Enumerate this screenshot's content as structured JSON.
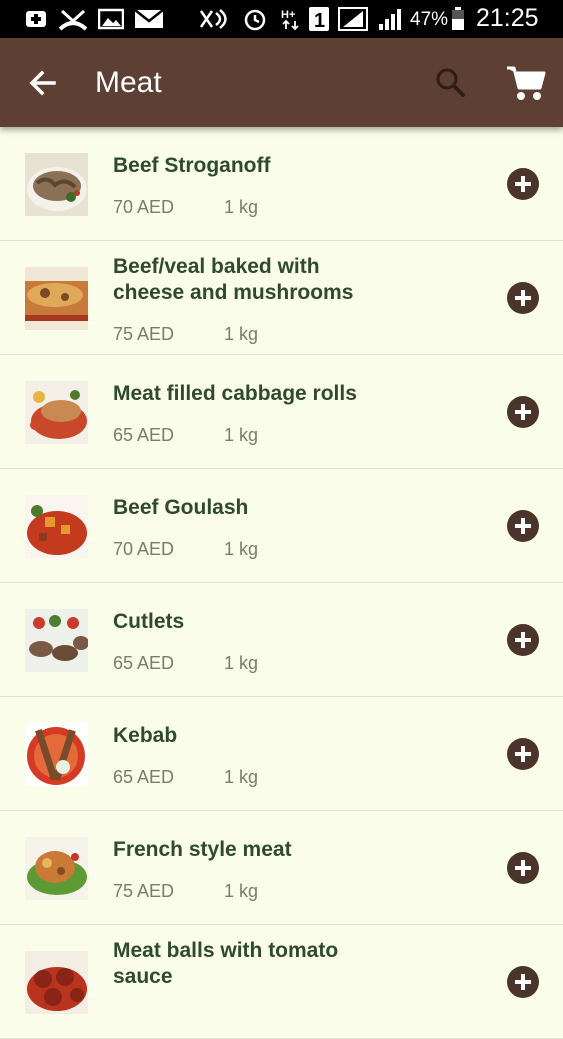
{
  "status_bar": {
    "battery": "47%",
    "time": "21:25"
  },
  "app_bar": {
    "title": "Meat",
    "icons": [
      "back-arrow-icon",
      "search-icon",
      "cart-icon"
    ]
  },
  "products": [
    {
      "name": "Beef Stroganoff",
      "price": "70 AED",
      "qty": "1 kg"
    },
    {
      "name": "Beef/veal baked with cheese and mushrooms",
      "price": "75 AED",
      "qty": "1 kg"
    },
    {
      "name": "Meat filled cabbage rolls",
      "price": "65 AED",
      "qty": "1 kg"
    },
    {
      "name": "Beef Goulash",
      "price": "70 AED",
      "qty": "1 kg"
    },
    {
      "name": "Cutlets",
      "price": "65 AED",
      "qty": "1 kg"
    },
    {
      "name": "Kebab",
      "price": "65 AED",
      "qty": "1 kg"
    },
    {
      "name": "French style meat",
      "price": "75 AED",
      "qty": "1 kg"
    },
    {
      "name": "Meat balls with tomato sauce",
      "price": "",
      "qty": ""
    }
  ],
  "colors": {
    "app_bar": "#5e3f33",
    "background": "#fbfdeb",
    "product_name": "#2f4a2e",
    "add_button": "#4a342b"
  }
}
